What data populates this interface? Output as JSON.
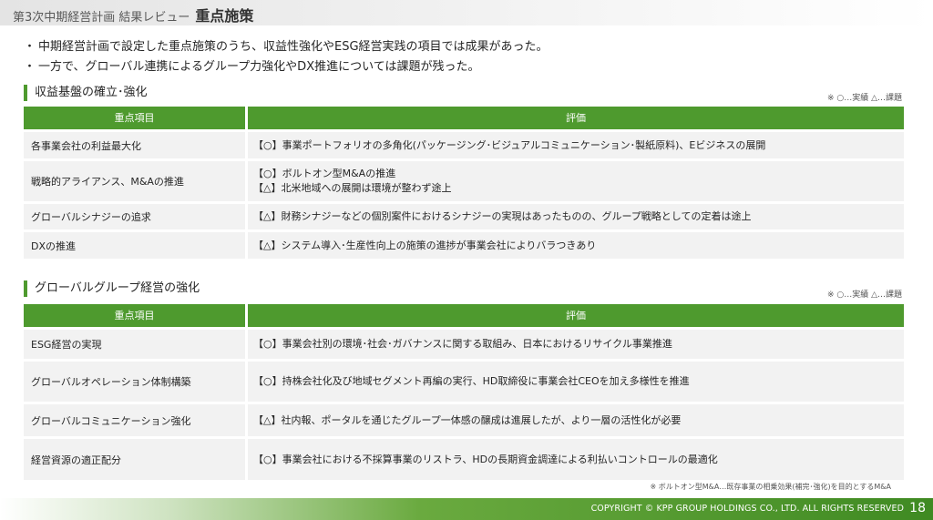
{
  "header": {
    "subtitle": "第3次中期経営計画 結果レビュー",
    "title": "重点施策"
  },
  "bullets": [
    {
      "marker": "・",
      "text": "中期経営計画で設定した重点施策のうち、収益性強化やESG経営実践の項目では成果があった。"
    },
    {
      "marker": "・",
      "text": "一方で、グローバル連携によるグループ力強化やDX推進については課題が残った。"
    }
  ],
  "sections": [
    {
      "title": "収益基盤の確立･強化",
      "legend": "※ ○…実績 △…課題",
      "col1": "重点項目",
      "col2": "評価",
      "rows": [
        {
          "item": "各事業会社の利益最大化",
          "evals": [
            "【○】事業ポートフォリオの多角化(パッケージング･ビジュアルコミュニケーション･製紙原料)、Eビジネスの展開"
          ]
        },
        {
          "item": "戦略的アライアンス、M&Aの推進",
          "evals": [
            "【○】ボルトオン型M&Aの推進",
            "【△】北米地域への展開は環境が整わず途上"
          ]
        },
        {
          "item": "グローバルシナジーの追求",
          "evals": [
            "【△】財務シナジーなどの個別案件におけるシナジーの実現はあったものの、グループ戦略としての定着は途上"
          ]
        },
        {
          "item": "DXの推進",
          "evals": [
            "【△】システム導入･生産性向上の施策の進捗が事業会社によりバラつきあり"
          ]
        }
      ]
    },
    {
      "title": "グローバルグループ経営の強化",
      "legend": "※ ○…実績 △…課題",
      "col1": "重点項目",
      "col2": "評価",
      "rows": [
        {
          "item": "ESG経営の実現",
          "evals": [
            "【○】事業会社別の環境･社会･ガバナンスに関する取組み、日本におけるリサイクル事業推進"
          ]
        },
        {
          "item": "グローバルオペレーション体制構築",
          "evals": [
            "【○】持株会社化及び地域セグメント再編の実行、HD取締役に事業会社CEOを加え多様性を推進"
          ]
        },
        {
          "item": "グローバルコミュニケーション強化",
          "evals": [
            "【△】社内報、ポータルを通じたグループ一体感の醸成は進展したが、より一層の活性化が必要"
          ]
        },
        {
          "item": "経営資源の適正配分",
          "evals": [
            "【○】事業会社における不採算事業のリストラ、HDの長期資金調達による利払いコントロールの最適化"
          ]
        }
      ]
    }
  ],
  "note": "※ ボルトオン型M&A…既存事業の相乗効果(補完･強化)を目的とするM&A",
  "footer": {
    "copyright": "COPYRIGHT © KPP GROUP HOLDINGS CO., LTD. ALL RIGHTS RESERVED",
    "page": "18"
  }
}
